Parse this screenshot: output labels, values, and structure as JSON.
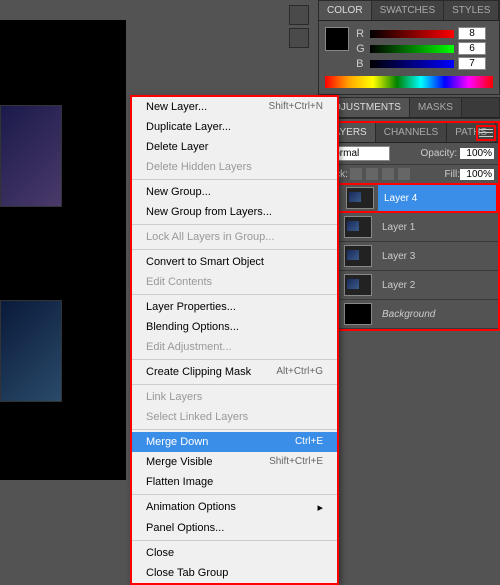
{
  "panels": {
    "color_tab": "COLOR",
    "swatches_tab": "SWATCHES",
    "styles_tab": "STYLES",
    "r": "R",
    "g": "G",
    "b": "B",
    "rv": "8",
    "gv": "6",
    "bv": "7",
    "adjustments": "ADJUSTMENTS",
    "masks": "MASKS",
    "layers": "LAYERS",
    "channels": "CHANNELS",
    "paths": "PATHS",
    "blend": "Normal",
    "opacity_lbl": "Opacity:",
    "opacity_val": "100%",
    "lock_lbl": "Lock:",
    "fill_lbl": "Fill:",
    "fill_val": "100%"
  },
  "layers": [
    {
      "name": "Layer 4",
      "sel": true
    },
    {
      "name": "Layer 1",
      "sel": false
    },
    {
      "name": "Layer 3",
      "sel": false
    },
    {
      "name": "Layer 2",
      "sel": false
    },
    {
      "name": "Background",
      "sel": false,
      "bg": true
    }
  ],
  "menu": [
    {
      "label": "New Layer...",
      "sc": "Shift+Ctrl+N"
    },
    {
      "label": "Duplicate Layer..."
    },
    {
      "label": "Delete Layer"
    },
    {
      "label": "Delete Hidden Layers",
      "dis": true
    },
    {
      "sep": true
    },
    {
      "label": "New Group..."
    },
    {
      "label": "New Group from Layers..."
    },
    {
      "sep": true
    },
    {
      "label": "Lock All Layers in Group...",
      "dis": true
    },
    {
      "sep": true
    },
    {
      "label": "Convert to Smart Object"
    },
    {
      "label": "Edit Contents",
      "dis": true
    },
    {
      "sep": true
    },
    {
      "label": "Layer Properties..."
    },
    {
      "label": "Blending Options..."
    },
    {
      "label": "Edit Adjustment...",
      "dis": true
    },
    {
      "sep": true
    },
    {
      "label": "Create Clipping Mask",
      "sc": "Alt+Ctrl+G"
    },
    {
      "sep": true
    },
    {
      "label": "Link Layers",
      "dis": true
    },
    {
      "label": "Select Linked Layers",
      "dis": true
    },
    {
      "sep": true
    },
    {
      "label": "Merge Down",
      "sc": "Ctrl+E",
      "hl": true
    },
    {
      "label": "Merge Visible",
      "sc": "Shift+Ctrl+E"
    },
    {
      "label": "Flatten Image"
    },
    {
      "sep": true
    },
    {
      "label": "Animation Options",
      "sub": true
    },
    {
      "label": "Panel Options..."
    },
    {
      "sep": true
    },
    {
      "label": "Close"
    },
    {
      "label": "Close Tab Group"
    }
  ]
}
